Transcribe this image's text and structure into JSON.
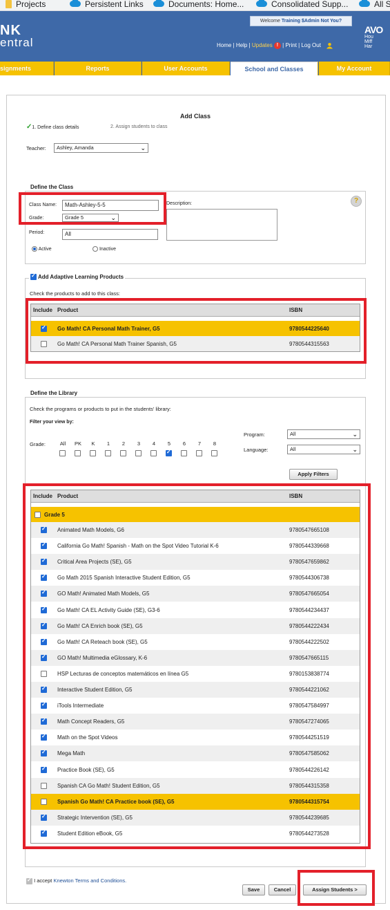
{
  "bookmarks": [
    {
      "label": "Projects",
      "icon": "bookmark-page-icon"
    },
    {
      "label": "Persistent Links",
      "icon": "cloud-icon"
    },
    {
      "label": "Documents: Home...",
      "icon": "cloud-icon"
    },
    {
      "label": "Consolidated Supp...",
      "icon": "cloud-icon"
    },
    {
      "label": "All S",
      "icon": "cloud-icon"
    }
  ],
  "header": {
    "logo_line1": "NK",
    "logo_line2": "entral",
    "welcome_prefix": "Welcome",
    "welcome_user": "Training $Admin",
    "welcome_not_you": "Not You?",
    "nav": {
      "home": "Home",
      "help": "Help",
      "updates": "Updates",
      "updates_badge": "!",
      "print": "Print",
      "logout": "Log Out"
    },
    "brand_mark": "AVO",
    "brand_lines": [
      "Hou",
      "Miff",
      "Har"
    ]
  },
  "tabs": [
    {
      "label": "signments"
    },
    {
      "label": "Reports"
    },
    {
      "label": "User Accounts"
    },
    {
      "label": "School and Classes"
    },
    {
      "label": "My Account"
    }
  ],
  "form": {
    "title": "Add Class",
    "step1": "1. Define class details",
    "step2": "2. Assign students to class",
    "teacher_label": "Teacher:",
    "teacher_value": "Ashley, Amanda",
    "define_class_legend": "Define the Class",
    "class_name_label": "Class Name:",
    "class_name_value": "Math-Ashley-5-5",
    "grade_label": "Grade:",
    "grade_value": "Grade 5",
    "description_label": "Description:",
    "period_label": "Period:",
    "period_value": "All",
    "active_label": "Active",
    "inactive_label": "Inactive",
    "help_glyph": "?"
  },
  "adaptive": {
    "legend": "Add Adaptive Learning Products",
    "instructions": "Check the products to add to this class:",
    "headers": {
      "include": "Include",
      "product": "Product",
      "isbn": "ISBN"
    },
    "rows": [
      {
        "product": "Go Math! CA Personal Math Trainer, G5",
        "isbn": "9780544225640",
        "checked": true
      },
      {
        "product": "Go Math! CA Personal Math Trainer Spanish, G5",
        "isbn": "9780544315563",
        "checked": false
      }
    ]
  },
  "library": {
    "legend": "Define the Library",
    "instructions": "Check the programs or products to put in the students' library:",
    "filter_label": "Filter your view by:",
    "grade_label": "Grade:",
    "grades": [
      "All",
      "PK",
      "K",
      "1",
      "2",
      "3",
      "4",
      "5",
      "6",
      "7",
      "8"
    ],
    "grades_checked": [
      false,
      false,
      false,
      false,
      false,
      false,
      false,
      true,
      false,
      false,
      false
    ],
    "program_label": "Program:",
    "program_value": "All",
    "language_label": "Language:",
    "language_value": "All",
    "apply_filters": "Apply Filters",
    "headers": {
      "include": "Include",
      "product": "Product",
      "isbn": "ISBN"
    },
    "group_label": "Grade 5",
    "rows": [
      {
        "product": "Animated Math Models, G6",
        "isbn": "9780547665108",
        "checked": true
      },
      {
        "product": "California Go Math! Spanish - Math on the Spot Video Tutorial K-6",
        "isbn": "9780544339668",
        "checked": true
      },
      {
        "product": "Critical Area Projects (SE), G5",
        "isbn": "9780547659862",
        "checked": true
      },
      {
        "product": "Go Math 2015 Spanish Interactive Student Edition, G5",
        "isbn": "9780544306738",
        "checked": true
      },
      {
        "product": "GO Math! Animated Math Models, G5",
        "isbn": "9780547665054",
        "checked": true
      },
      {
        "product": "Go Math! CA EL Activity Guide (SE), G3-6",
        "isbn": "9780544234437",
        "checked": true
      },
      {
        "product": "Go Math! CA Enrich book (SE), G5",
        "isbn": "9780544222434",
        "checked": true
      },
      {
        "product": "Go Math! CA Reteach book (SE), G5",
        "isbn": "9780544222502",
        "checked": true
      },
      {
        "product": "GO Math! Multimedia eGlossary, K-6",
        "isbn": "9780547665115",
        "checked": true
      },
      {
        "product": "HSP Lecturas de conceptos matemáticos en línea G5",
        "isbn": "9780153838774",
        "checked": false
      },
      {
        "product": "Interactive Student Edition, G5",
        "isbn": "9780544221062",
        "checked": true
      },
      {
        "product": "iTools Intermediate",
        "isbn": "9780547584997",
        "checked": true
      },
      {
        "product": "Math Concept Readers, G5",
        "isbn": "9780547274065",
        "checked": true
      },
      {
        "product": "Math on the Spot Videos",
        "isbn": "9780544251519",
        "checked": true
      },
      {
        "product": "Mega Math",
        "isbn": "9780547585062",
        "checked": true
      },
      {
        "product": "Practice Book (SE), G5",
        "isbn": "9780544226142",
        "checked": true
      },
      {
        "product": "Spanish CA Go Math! Student Edition, G5",
        "isbn": "9780544315358",
        "checked": false
      },
      {
        "product": "Spanish Go Math! CA Practice book (SE), G5",
        "isbn": "9780544315754",
        "checked": false,
        "highlight": true
      },
      {
        "product": "Strategic Intervention (SE), G5",
        "isbn": "9780544239685",
        "checked": true
      },
      {
        "product": "Student Edition eBook, G5",
        "isbn": "9780544273528",
        "checked": true
      }
    ]
  },
  "footer": {
    "accept_prefix": "I accept",
    "terms_link": "Knewton Terms and Conditions.",
    "save": "Save",
    "cancel": "Cancel",
    "assign": "Assign Students >"
  },
  "colors": {
    "header_blue": "#3e69a8",
    "tab_gold": "#f6c200",
    "highlight_red": "#e3202a",
    "link_blue": "#1f4f96"
  }
}
